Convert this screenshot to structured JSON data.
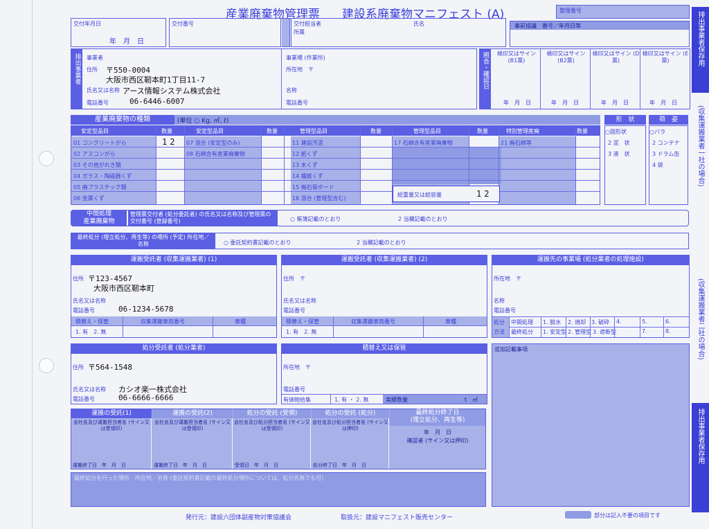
{
  "header": {
    "title": "産業廃棄物管理票",
    "subtitle": "建設系廃棄物マニフェスト (A)",
    "seiri": "整理番号",
    "issue_date": "交付年月日",
    "date_ymd": "年　月　日",
    "issue_no": "交付番号",
    "tanto": "交付担当者",
    "shozoku": "所属",
    "shimei": "氏名",
    "jizen": "事前協議　番号／年月日等"
  },
  "generator": {
    "side_label": "排出事業者",
    "jigyosha": "事業者",
    "jusho_label": "住所",
    "postal": "〒550-0004",
    "address": "大阪市西区靭本町1丁目11-7",
    "name_label": "氏名又は名称",
    "name": "アース情報システム株式会社",
    "tel_label": "電話番号",
    "tel": "06-6446-6007",
    "site": "事業場 (作業所)",
    "site_addr": "所在地　〒",
    "site_name": "名称",
    "site_tel": "電話番号"
  },
  "confirm": {
    "label": "照合・確認日",
    "cols": [
      "検印又はサイン (B1票)",
      "検印又はサイン (B2票)",
      "検印又はサイン (D票)",
      "検印又はサイン (E票)"
    ],
    "ymd": "年　月　日"
  },
  "waste": {
    "type_header": "産業廃棄物の種類",
    "unit": "(単位 ○ Kg, ㎥, ℓ)",
    "cols": [
      "安定型品目",
      "数量",
      "安定型品目",
      "数量",
      "管理型品目",
      "数量",
      "管理型品目",
      "数量",
      "特別管理産廃",
      "数量"
    ],
    "col1": [
      "01 コンクリートがら",
      "02 アスコンがら",
      "03 その他がれき類",
      "04 ガラス・陶磁器くず",
      "05 廃プラスチック類",
      "06 金属くず"
    ],
    "col1_qty": "12",
    "col2": [
      "07 混合 (安定型のみ)",
      "08 石綿含有産業廃棄物"
    ],
    "col3": [
      "11 建設汚泥",
      "12 紙くず",
      "13 木くず",
      "14 繊維くず",
      "15 廃石膏ボード",
      "16 混合 (管理型含む)"
    ],
    "col4": [
      "17 石綿含有産業廃棄物"
    ],
    "col5": [
      "21 廃石綿等"
    ],
    "total_label": "総重量又は総容量",
    "total_value": "12",
    "form_header": "形　状",
    "form": [
      "○固形状",
      "2 泥　状",
      "3 液　状"
    ],
    "pack_header": "荷　姿",
    "pack": [
      "○バラ",
      "2 コンテナ",
      "3 ドラム缶",
      "4 袋"
    ]
  },
  "intermediate": {
    "label1": "中間処理",
    "label2": "産業廃棄物",
    "desc": "管理票交付者 (処分委託者) の氏名又は名称及び管理票の交付番号 (登録番号)",
    "opt1": "○ 帳簿記載のとおり",
    "opt2": "2 当欄記載のとおり"
  },
  "final": {
    "label": "最終処分 (埋立処分、再生等) の場所 (予定) 所在地／名称",
    "opt1": "○ 委託契約書記載のとおり",
    "opt2": "2 当欄記載のとおり"
  },
  "carrier1": {
    "title": "運搬受託者 (収集運搬業者) (1)",
    "jusho": "住所",
    "postal": "〒123-4567",
    "address": "大阪市西区靭本町",
    "name_label": "氏名又は名称",
    "tel_label": "電話番号",
    "tel": "06-1234-5678",
    "tsumikae": "積替え・保管",
    "car_no": "収集運搬車両番号",
    "car_type": "車種",
    "umu": "1. 有　2. 無"
  },
  "carrier2": {
    "title": "運搬受託者 (収集運搬業者) (2)",
    "jusho": "住所　〒",
    "name_label": "氏名又は名称",
    "tel_label": "電話番号",
    "tsumikae": "積替え・保管",
    "car_no": "収集運搬車両番号",
    "car_type": "車種",
    "umu": "1. 有　2. 無"
  },
  "destination": {
    "title": "運搬先の事業場 (処分業者の処理施設)",
    "addr": "所在地　〒",
    "name": "名称",
    "tel": "電話番号",
    "shobun": "処分",
    "hoho": "方法",
    "chukan": "中間処理",
    "saishu": "最終処分",
    "m1": [
      "1. 脱水",
      "2. 焼却",
      "3. 破砕",
      "4.",
      "5.",
      "6."
    ],
    "m2": [
      "1. 安定型",
      "2. 管理型",
      "3. 遮断型",
      "7.",
      "8."
    ]
  },
  "disposer": {
    "title": "処分受託者 (処分業者)",
    "jusho": "住所",
    "postal": "〒564-1548",
    "name_label": "氏名又は名称",
    "name": "カシオ楽一株式会社",
    "tel_label": "電話番号",
    "tel": "06-6666-6666"
  },
  "storage": {
    "title": "積替え又は保管",
    "addr": "所在地　〒",
    "tel": "電話番号",
    "yuka": "有価物拾集",
    "umu": "1. 有 ・ 2. 無",
    "qty": "実績数量",
    "unit": "t　㎥"
  },
  "additional": {
    "title": "追加記載事項"
  },
  "receipts": {
    "r1": "運搬の受託(1)",
    "r2": "運搬の受託(2)",
    "r3": "処分の受託 (受領)",
    "r4": "処分の受託 (処分)",
    "r5": "最終処分終了日",
    "r5b": "(埋立処分、再生等)",
    "r5ymd": "年　月　日",
    "r5sign": "確認者 (サイン又は押印)",
    "sub1": "会社名及び運搬担当者名 (サイン又は受領印)",
    "sub3": "会社名及び処分担当者名 (サイン又は受領印)",
    "sub4": "会社名及び処分担当者名 (サイン又は押印)",
    "d1": "運搬終了日　年　月　日",
    "d2": "運搬終了日　年　月　日",
    "d3": "受領日　年　月　日",
    "d4": "処分終了日　年　月　日",
    "bottom_note": "最終処分を行った場所　所在地／名称 (委託契約書記載の最終処分場所については、処分先無でも可)"
  },
  "footer": {
    "publisher": "発行元：建設六団体副産物対策協議会",
    "distributor": "取扱元：建設マニフェスト販売センター",
    "legend": "部分は記入不要の項目です"
  },
  "side": {
    "top": "排出事業者保存用",
    "mid1": "(収集運搬業者一社の場合)",
    "mid2": "(収集運搬業者二社の場合)",
    "bottom": "排出事業者保存用"
  },
  "colors": {
    "blue": "#3b3fd8",
    "fill": "#a8b2e8",
    "header": "#5a5fe4"
  }
}
